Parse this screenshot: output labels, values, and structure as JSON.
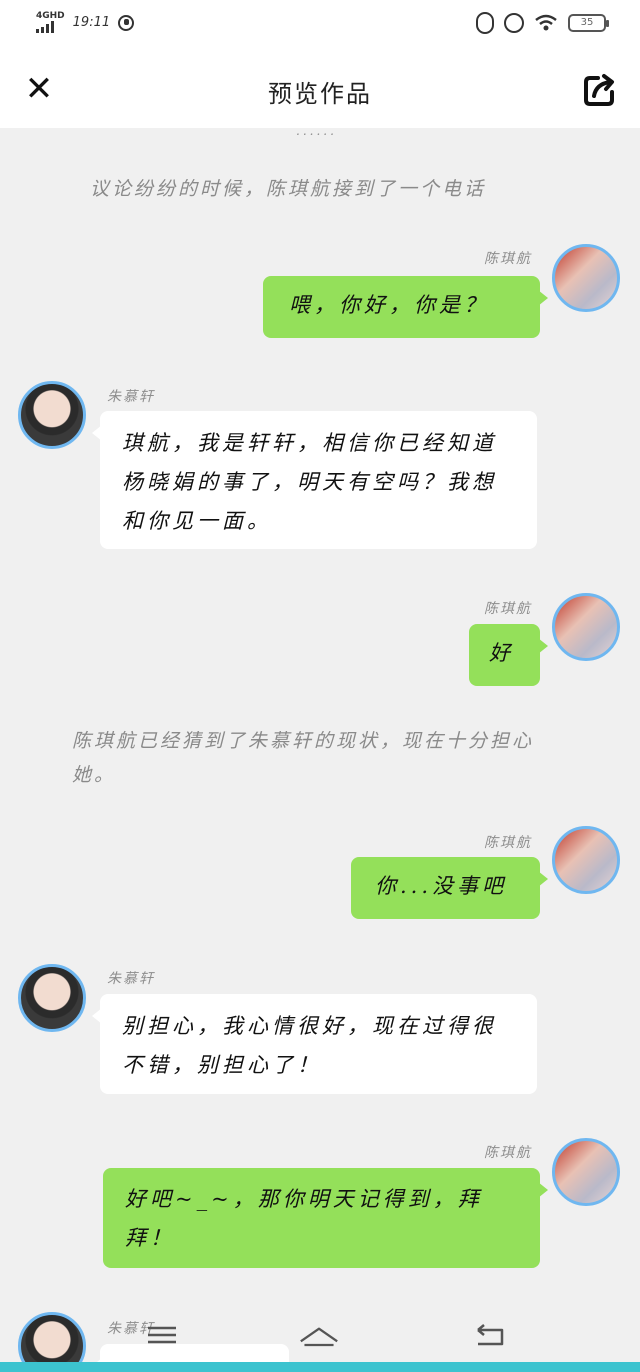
{
  "status": {
    "network": "4GHD",
    "time": "19:11",
    "battery": "35"
  },
  "header": {
    "title": "预览作品"
  },
  "narration": {
    "top_fragment": "......",
    "n1": "议论纷纷的时候，陈琪航接到了一个电话",
    "n2": "陈琪航已经猜到了朱慕轩的现状，现在十分担心她。"
  },
  "characters": {
    "right": "陈琪航",
    "left": "朱慕轩"
  },
  "messages": [
    {
      "side": "right",
      "name": "陈琪航",
      "text": "喂，你好，你是？"
    },
    {
      "side": "left",
      "name": "朱慕轩",
      "text": "琪航，我是轩轩，相信你已经知道杨晓娟的事了，明天有空吗？我想和你见一面。"
    },
    {
      "side": "right",
      "name": "陈琪航",
      "text": "好"
    },
    {
      "side": "right",
      "name": "陈琪航",
      "text": "你...没事吧"
    },
    {
      "side": "left",
      "name": "朱慕轩",
      "text": "别担心，我心情很好，现在过得很不错，别担心了！"
    },
    {
      "side": "right",
      "name": "陈琪航",
      "text": "好吧~_~，那你明天记得到，拜拜！"
    },
    {
      "side": "left",
      "name": "朱慕轩",
      "text": "......"
    }
  ],
  "colors": {
    "bubble_right": "#94e05a",
    "bubble_left": "#ffffff",
    "avatar_ring": "#6fb7f0",
    "background": "#f0f0f0"
  }
}
